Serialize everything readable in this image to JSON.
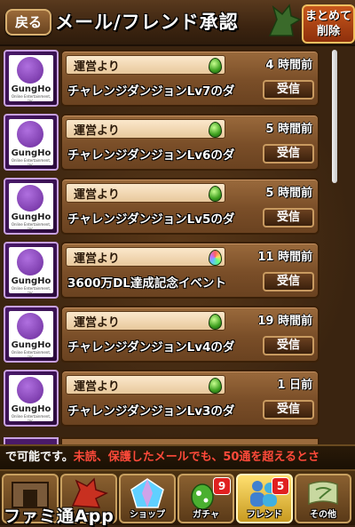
{
  "header": {
    "back_label": "戻る",
    "title": "メール/フレンド承認",
    "bulk_delete_label": "まとめて\n削除"
  },
  "avatar": {
    "logo_text": "GungHo",
    "logo_sub": "Online Entertainment, Inc."
  },
  "mails": [
    {
      "sender": "運営より",
      "time": "4 時間前",
      "subject": "チャレンジダンジョンLv7のダ",
      "button": "受信",
      "egg": "green"
    },
    {
      "sender": "運営より",
      "time": "5 時間前",
      "subject": "チャレンジダンジョンLv6のダ",
      "button": "受信",
      "egg": "green"
    },
    {
      "sender": "運営より",
      "time": "5 時間前",
      "subject": "チャレンジダンジョンLv5のダ",
      "button": "受信",
      "egg": "green"
    },
    {
      "sender": "運営より",
      "time": "11 時間前",
      "subject": "3600万DL達成記念イベント",
      "button": "受信",
      "egg": "rainbow"
    },
    {
      "sender": "運営より",
      "time": "19 時間前",
      "subject": "チャレンジダンジョンLv4のダ",
      "button": "受信",
      "egg": "green"
    },
    {
      "sender": "運営より",
      "time": "1 日前",
      "subject": "チャレンジダンジョンLv3のダ",
      "button": "受信",
      "egg": "green"
    }
  ],
  "ticker": {
    "text_white": "で可能です。",
    "text_red": "未読、保護したメールでも、50通を超えるとさ"
  },
  "nav": [
    {
      "label": "",
      "badge": ""
    },
    {
      "label": "ー",
      "badge": ""
    },
    {
      "label": "ショップ",
      "badge": ""
    },
    {
      "label": "ガチャ",
      "badge": "9"
    },
    {
      "label": "フレンド",
      "badge": "5"
    },
    {
      "label": "その他",
      "badge": ""
    }
  ],
  "watermark": "ファミ通App",
  "colors": {
    "panel": "#7a4e28",
    "ticker_red": "#ff4a3a",
    "badge": "#e02020",
    "bulk_button": "#c8581c"
  }
}
